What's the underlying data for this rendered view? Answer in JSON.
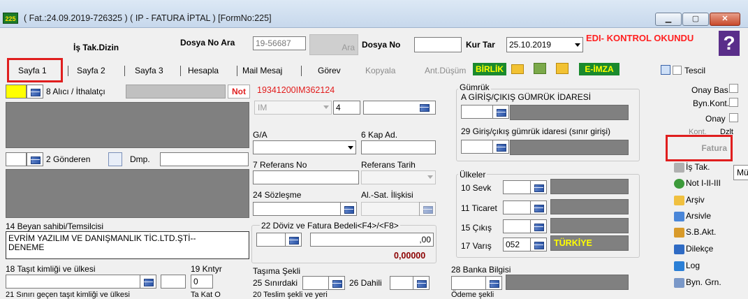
{
  "window": {
    "title": "( Fat.:24.09.2019-726325 ) ( IP  - FATURA İPTAL ) [FormNo:225]",
    "app_icon": "app-logo-icon",
    "controls": [
      "minimize",
      "maximize",
      "close"
    ]
  },
  "toolbar": {
    "is_tak_dizin": "İş Tak.Dizin",
    "dosya_no_ara_label": "Dosya No Ara",
    "dosya_no_ara_value": "19-56687",
    "ara_button": "Ara",
    "dosya_no_label": "Dosya No",
    "dosya_no_value": "",
    "kur_tar_label": "Kur Tar",
    "kur_tar_value": "25.10.2019",
    "edi_status": "EDI- KONTROL OKUNDU",
    "help_button": "?"
  },
  "tabs": {
    "items": [
      "Sayfa 1",
      "Sayfa 2",
      "Sayfa 3",
      "Hesapla",
      "Mail Mesaj",
      "Görev",
      "Kopyala",
      "Ant.Düşüm"
    ],
    "active": "Sayfa 1"
  },
  "toolbar_icons": {
    "birlik": "BİRLİK",
    "eimza": "E-İMZA",
    "tescil": "Tescil"
  },
  "form": {
    "alici_label": "8 Alıcı / İthalatçı",
    "not_button": "Not",
    "tracking_no": "19341200IM362124",
    "im_combo": "IM",
    "im_num": "4",
    "ga_label": "G/A",
    "kap_ad_label": "6 Kap Ad.",
    "gonderen_label": "2 Gönderen",
    "dmp_label": "Dmp.",
    "referans_no_label": "7 Referans No",
    "referans_tarih_label": "Referans Tarih",
    "sozlesme_label": "24 Sözleşme",
    "al_sat_label": "Al.-Sat. İlişkisi",
    "beyan_label": "14 Beyan sahibi/Temsilcisi",
    "beyan_value": "EVRİM YAZILIM VE DANIŞMANLIK TİC.LTD.ŞTİ--\nDENEME",
    "doviz_label": "22 Döviz ve Fatura Bedeli<F4>/<F8>",
    "doviz_value": ",00",
    "doviz_total": "0,00000",
    "tasit_label": "18 Taşıt kimliği ve ülkesi",
    "kntyr_label": "19 Kntyr",
    "kntyr_value": "0",
    "tasima_label": "Taşıma Şekli",
    "sinirdaki_label": "25 Sınırdaki",
    "dahili_label": "26 Dahili",
    "banka_label": "28 Banka Bilgisi",
    "bottom_cut_1": "21 Sınırı geçen taşıt kimliği ve ülkesi",
    "bottom_cut_2": "Ta Kat O",
    "bottom_cut_3": "20 Teslim şekli ve yeri",
    "bottom_cut_4": "Ödeme şekli"
  },
  "gumruk": {
    "title": "Gümrük",
    "idare_label": "A GİRİŞ/ÇIKIŞ GÜMRÜK İDARESİ",
    "sinir_label": "29 Giriş/çıkış gümrük idaresi (sınır girişi)"
  },
  "ulkeler": {
    "title": "Ülkeler",
    "rows": [
      {
        "label": "10 Sevk",
        "code": "",
        "name": ""
      },
      {
        "label": "11 Ticaret",
        "code": "",
        "name": ""
      },
      {
        "label": "15 Çıkış",
        "code": "",
        "name": ""
      },
      {
        "label": "17 Varış",
        "code": "052",
        "name": "TÜRKİYE"
      }
    ]
  },
  "right_panel": {
    "onay_bas": "Onay Bas.",
    "byn_kont": "Byn.Kont.",
    "onay": "Onay",
    "kont": "Kont.",
    "dzlt": "Dzlt",
    "fatura": "Fatura",
    "items": [
      "İş Tak.",
      "Not I-II-III",
      "Arşiv",
      "Arsivle",
      "S.B.Akt.",
      "Dilekçe",
      "Log",
      "Byn. Grn."
    ],
    "cut_label": "Mü"
  },
  "colors": {
    "gray_field": "#808080",
    "red_highlight": "#e01e1e",
    "yellow_field": "#ffff00",
    "green_button": "#1a8a2e",
    "edi_red": "#ff2020"
  }
}
